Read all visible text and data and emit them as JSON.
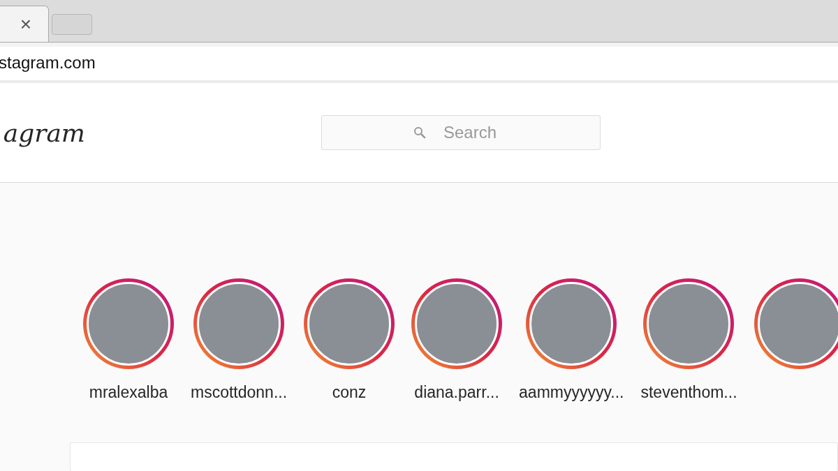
{
  "browser": {
    "tabs": [
      {
        "selected": true
      },
      {
        "selected": false
      }
    ],
    "close_icon": "×",
    "address": "stagram.com"
  },
  "header": {
    "logo": "agram",
    "search": {
      "placeholder": "Search"
    }
  },
  "stories": [
    {
      "username": "mralexalba"
    },
    {
      "username": "mscottdonn..."
    },
    {
      "username": "conz"
    },
    {
      "username": "diana.parr..."
    },
    {
      "username": "aammyyyyyy..."
    },
    {
      "username": "steventhom..."
    }
  ]
}
